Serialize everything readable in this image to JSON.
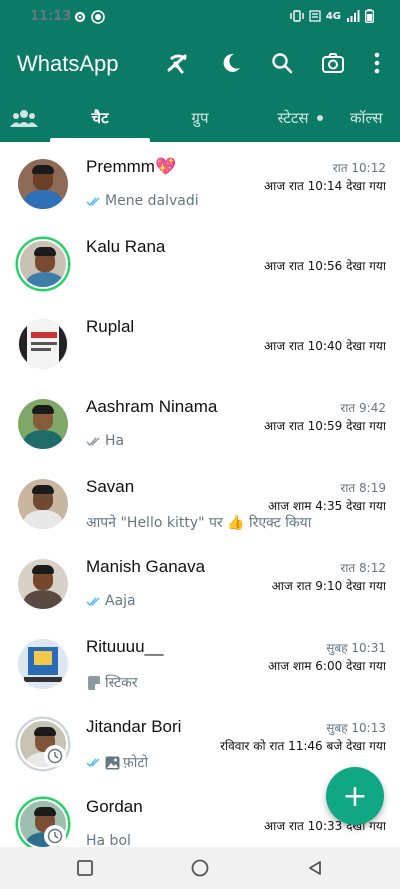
{
  "status_bar": {
    "time": "11:13",
    "network": "4G",
    "icons": [
      "settings-icon",
      "record-icon",
      "vibrate-icon",
      "volte-icon",
      "signal-icon",
      "battery-icon"
    ]
  },
  "app_bar": {
    "title": "WhatsApp",
    "actions": [
      "wifi-off-icon",
      "moon-icon",
      "search-icon",
      "camera-icon",
      "more-vert-icon"
    ]
  },
  "tabs": [
    {
      "label": "",
      "icon": "community-icon"
    },
    {
      "label": "चैट",
      "active": true
    },
    {
      "label": "ग्रुप"
    },
    {
      "label": "स्टेटस",
      "dot": true
    },
    {
      "label": "कॉल्स"
    }
  ],
  "chats": [
    {
      "name": "Premmm💖",
      "time": "रात 10:12",
      "seen": "आज रात 10:14 देखा गया",
      "message": "Mene dalvadi",
      "ticks": "blue"
    },
    {
      "name": "Kalu Rana",
      "time": "",
      "seen": "आज रात 10:56 देखा गया",
      "message": ""
    },
    {
      "name": "Ruplal",
      "time": "",
      "seen": "आज रात 10:40 देखा गया",
      "message": ""
    },
    {
      "name": "Aashram Ninama",
      "time": "रात 9:42",
      "seen": "आज रात 10:59 देखा गया",
      "message": "Ha",
      "ticks": "grey"
    },
    {
      "name": "Savan",
      "time": "रात 8:19",
      "seen": "आज शाम 4:35 देखा गया",
      "message": "आपने \"Hello kitty\" पर 👍 रिएक्ट किया"
    },
    {
      "name": "Manish Ganava",
      "time": "रात 8:12",
      "seen": "आज रात 9:10 देखा गया",
      "message": "Aaja",
      "ticks": "blue"
    },
    {
      "name": "Rituuuu__",
      "time": "सुबह 10:31",
      "seen": "आज शाम 6:00 देखा गया",
      "message": "स्टिकर"
    },
    {
      "name": "Jitandar Bori",
      "time": "सुबह 10:13",
      "seen": "रविवार को रात 11:46 बजे देखा गया",
      "message": "फ़ोटो",
      "ticks": "blue"
    },
    {
      "name": "Gordan",
      "time": "",
      "seen": "आज रात 10:33 देखा गया",
      "message": "Ha bol"
    }
  ],
  "fab": {
    "label": "+"
  },
  "colors": {
    "primary": "#0b7a66",
    "accent": "#10a884",
    "read_tick": "#53bdeb",
    "ring": "#25d366"
  }
}
